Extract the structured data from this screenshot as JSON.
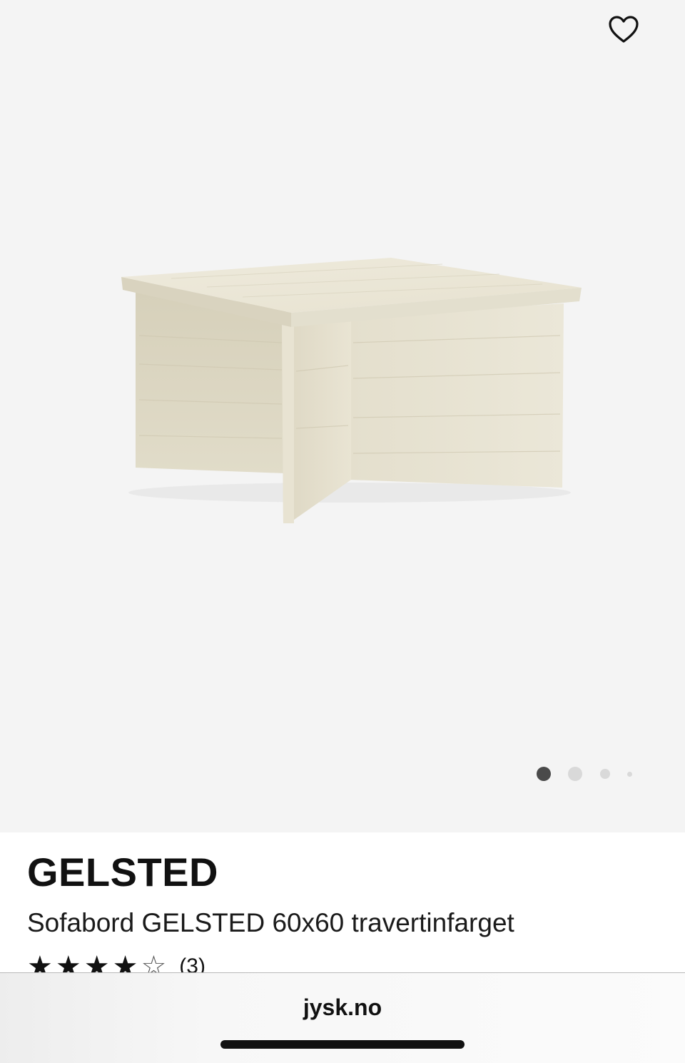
{
  "product": {
    "brand": "GELSTED",
    "title": "Sofabord GELSTED 60x60 travertinfarget",
    "rating": 4,
    "rating_max": 5,
    "review_count": "(3)"
  },
  "gallery": {
    "image_count": 4,
    "active_index": 0,
    "favorite_icon": "heart-outline-icon",
    "dot_active_color": "#4a4a4a",
    "dot_inactive_color": "#d9d9d9"
  },
  "browser": {
    "url": "jysk.no"
  },
  "colors": {
    "gallery_bg": "#f4f4f4",
    "travertine": "#e6e2d0"
  }
}
